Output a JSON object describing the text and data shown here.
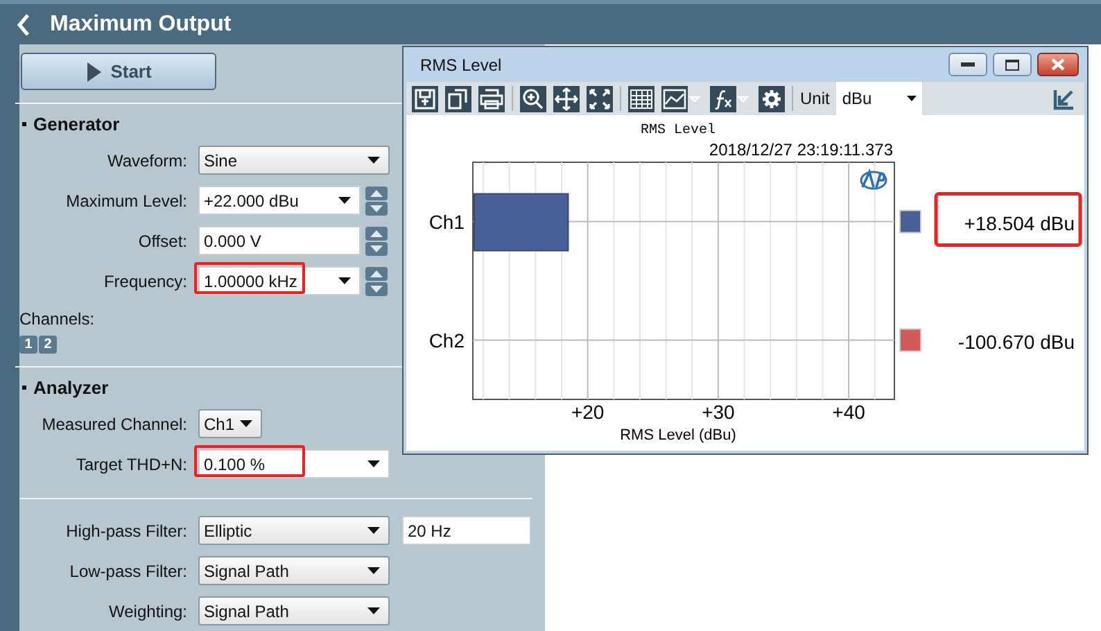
{
  "header": {
    "title": "Maximum Output"
  },
  "start_button": {
    "label": "Start"
  },
  "generator": {
    "title": "Generator",
    "fields": [
      {
        "label": "Waveform:",
        "value": "Sine",
        "kind": "dropdown"
      },
      {
        "label": "Maximum Level:",
        "value": "+22.000 dBu",
        "kind": "combo-spin"
      },
      {
        "label": "Offset:",
        "value": "0.000 V",
        "kind": "spin"
      },
      {
        "label": "Frequency:",
        "value": "1.00000 kHz",
        "kind": "combo-spin",
        "highlighted": true
      }
    ],
    "channels_label": "Channels:",
    "channel_buttons": [
      "1",
      "2"
    ]
  },
  "analyzer": {
    "title": "Analyzer",
    "fields": [
      {
        "label": "Measured Channel:",
        "value": "Ch1",
        "kind": "small-dropdown"
      },
      {
        "label": "Target THD+N:",
        "value": "0.100 %",
        "kind": "combo",
        "highlighted": true
      }
    ],
    "filters": [
      {
        "label": "High-pass Filter:",
        "value": "Elliptic",
        "kind": "dropdown",
        "extra": "20 Hz"
      },
      {
        "label": "Low-pass Filter:",
        "value": "Signal Path",
        "kind": "dropdown"
      },
      {
        "label": "Weighting:",
        "value": "Signal Path",
        "kind": "dropdown"
      }
    ]
  },
  "chart_window": {
    "title": "RMS Level",
    "unit_label": "Unit",
    "unit_value": "dBu",
    "chart_title": "RMS Level",
    "timestamp": "2018/12/27 23:19:11.373",
    "chart_data": {
      "type": "bar",
      "orientation": "horizontal",
      "categories": [
        "Ch1",
        "Ch2"
      ],
      "series": [
        {
          "color": "#485f98",
          "values": [
            18.5,
            null
          ]
        }
      ],
      "grid": true,
      "xlabel": "RMS Level (dBu)",
      "xlim": [
        11.2,
        43.5
      ],
      "xticks": [
        {
          "value": 20,
          "label": "+20"
        },
        {
          "value": 30,
          "label": "+30"
        },
        {
          "value": 40,
          "label": "+40"
        }
      ]
    },
    "readings": [
      {
        "value": "+18.504 dBu",
        "color": "#485f98",
        "highlighted": true
      },
      {
        "value": "-100.670 dBu",
        "color": "#d05a55"
      }
    ]
  }
}
